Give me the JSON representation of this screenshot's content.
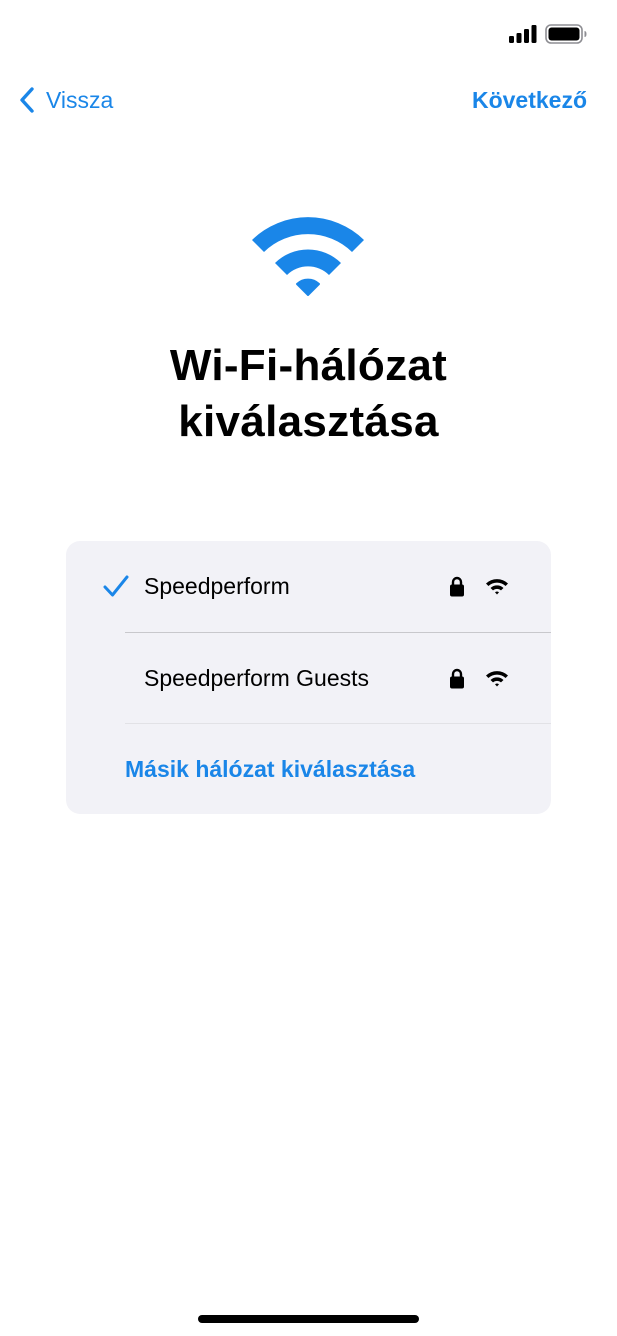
{
  "colors": {
    "accent": "#1a86e8",
    "card_background": "#f2f2f7",
    "text": "#000000"
  },
  "status_bar": {
    "icons": [
      "cellular-signal-icon",
      "battery-icon"
    ]
  },
  "nav": {
    "back_label": "Vissza",
    "next_label": "Következő"
  },
  "hero_icon": "wifi-icon",
  "title": {
    "line1": "Wi-Fi-hálózat",
    "line2": "kiválasztása"
  },
  "networks": [
    {
      "name": "Speedperform",
      "selected": true,
      "secured": true,
      "icons": [
        "checkmark-icon",
        "lock-icon",
        "wifi-icon"
      ]
    },
    {
      "name": "Speedperform Guests",
      "selected": false,
      "secured": true,
      "icons": [
        "lock-icon",
        "wifi-icon"
      ]
    }
  ],
  "other_network_label": "Másik hálózat kiválasztása"
}
